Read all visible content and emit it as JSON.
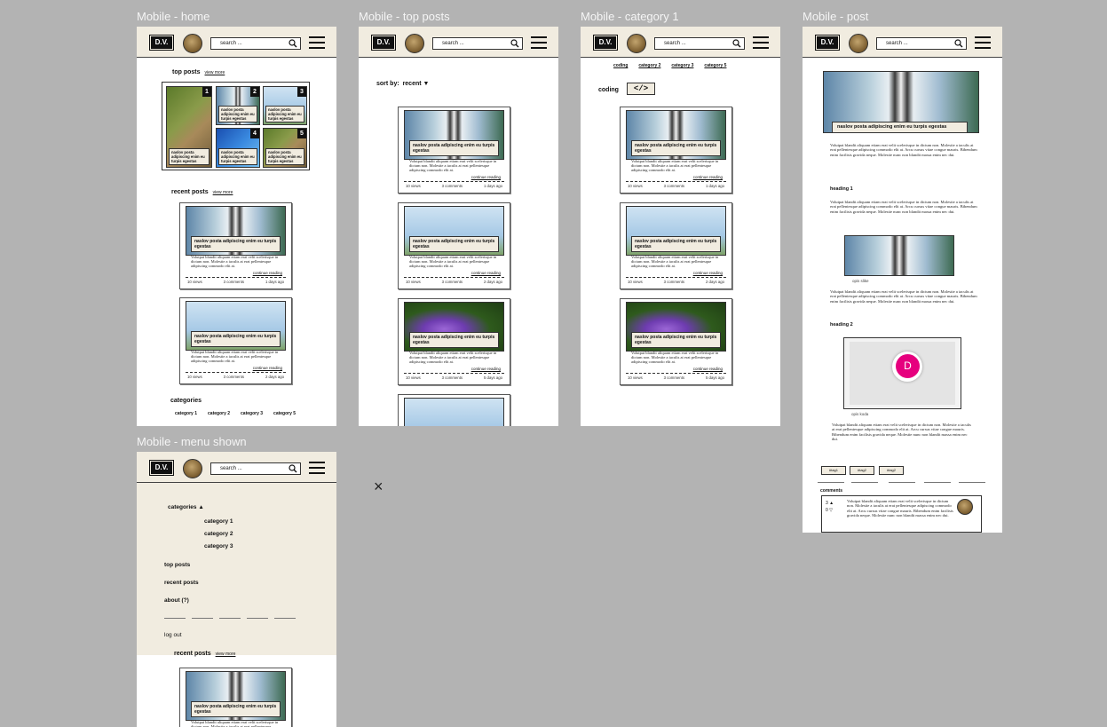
{
  "frames": {
    "home": "Mobile - home",
    "top_posts": "Mobile - top posts",
    "category": "Mobile - category 1",
    "post": "Mobile - post",
    "menu": "Mobile - menu shown"
  },
  "header": {
    "logo": "D.V.",
    "search_placeholder": "search ..."
  },
  "sections": {
    "top_posts": "top posts",
    "recent_posts": "recent posts",
    "view_more": "view more",
    "categories": "categories"
  },
  "categories": [
    "category 1",
    "category 2",
    "category 3",
    "category 5"
  ],
  "category_tabs": [
    "coding",
    "category 2",
    "category 3",
    "category 5"
  ],
  "top_post_title": "naslov posta adipiscing enim eu turpis egestas",
  "post": {
    "title": "naslov posta adipiscing enim eu turpis egestas",
    "excerpt": "Volutpat blandit aliquam etiam erat velit scelerisque in dictum non. Molestie a iaculis at erat pellentesque adipiscing commodo elit at.",
    "continue": "continue reading",
    "views": "10 views",
    "comments": "3 comments",
    "dates": [
      "1 days ago",
      "2 days ago",
      "5 days ago"
    ]
  },
  "sort": {
    "label": "sort by:",
    "value": "recent"
  },
  "category_page": {
    "heading": "coding",
    "icon": "</>"
  },
  "article": {
    "title": "naslov posta adipiscing enim eu turpis egestas",
    "paragraph": "Volutpat blandit aliquam etiam erat velit scelerisque in dictum non. Molestie a iaculis at erat pellentesque adipiscing commodo elit at. Arcu cursus vitae congue mauris. Bibendum enim facilisis gravida neque. Molestie nunc non blandit massa enim nec dui.",
    "heading1": "heading 1",
    "heading2": "heading 2",
    "img_caption": "opis slike",
    "code_caption": "opis koda",
    "tags": [
      "#tag1",
      "#tag2",
      "#tag2"
    ],
    "comments_label": "comments",
    "votes_up": "3",
    "votes_down": "0",
    "comment_text": "Volutpat blandit aliquam etiam erat velit scelerisque in dictum non. Molestie a iaculis at erat pellentesque adipiscing commodo elit at. Arcu cursus vitae congue mauris. Bibendum enim facilisis gravida neque. Molestie nunc non blandit massa enim nec dui.",
    "cursor_badge": "D"
  },
  "menu": {
    "categories": "categories",
    "items": [
      "category 1",
      "category 2",
      "category 3"
    ],
    "top_posts": "top posts",
    "recent_posts": "recent posts",
    "about": "about (?)",
    "logout": "log out"
  },
  "close_glyph": "×",
  "colors": {
    "canvas": "#b3b3b3",
    "header": "#f1ece0",
    "cursor_badge": "#e6007e"
  }
}
